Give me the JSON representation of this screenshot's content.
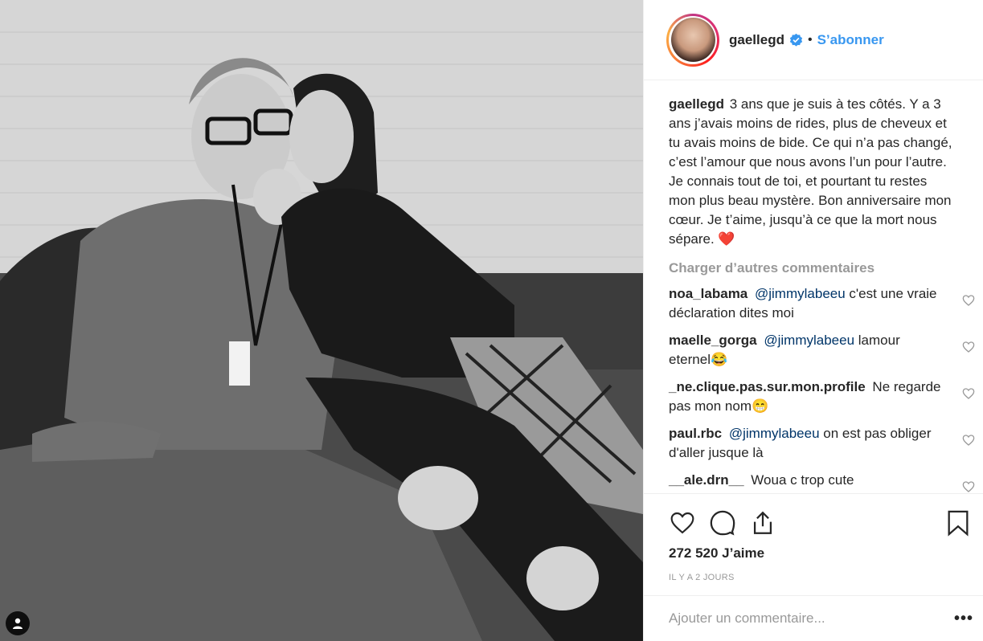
{
  "post": {
    "username": "gaellegd",
    "follow_label": "S’abonner",
    "dot": "•",
    "caption_author": "gaellegd",
    "caption_text": "3 ans que je suis à tes côtés. Y a 3 ans j’avais moins de rides, plus de cheveux et tu avais moins de bide. Ce qui n’a pas changé, c’est l’amour que nous avons l’un pour l’autre. Je connais tout de toi, et pourtant tu restes mon plus beau mystère. Bon anniversaire mon cœur. Je t’aime, jusqu’à ce que la mort nous sépare. ❤️",
    "load_more": "Charger d’autres commentaires",
    "likes": "272 520 J’aime",
    "time": "IL Y A 2 JOURS",
    "add_comment_placeholder": "Ajouter un commentaire...",
    "more_label": "•••"
  },
  "comments": [
    {
      "author": "noa_labama",
      "mention": "@jimmylabeeu",
      "text": "c'est une vraie déclaration dites moi"
    },
    {
      "author": "maelle_gorga",
      "mention": "@jimmylabeeu",
      "text": "lamour eternel😂"
    },
    {
      "author": "_ne.clique.pas.sur.mon.profile",
      "mention": "",
      "text": "Ne regarde pas mon nom😁"
    },
    {
      "author": "paul.rbc",
      "mention": "@jimmylabeeu",
      "text": "on est pas obliger d'aller jusque là"
    },
    {
      "author": "__ale.drn__",
      "mention": "",
      "text": "Woua c trop cute"
    }
  ],
  "colors": {
    "link": "#3897f0",
    "mention": "#003569",
    "verified": "#3897f0",
    "heart_emoji": "#ed4956"
  },
  "icons": [
    "tag-user-icon",
    "verified-badge-icon",
    "heart-icon",
    "comment-icon",
    "share-icon",
    "bookmark-icon",
    "like-comment-heart-icon"
  ]
}
